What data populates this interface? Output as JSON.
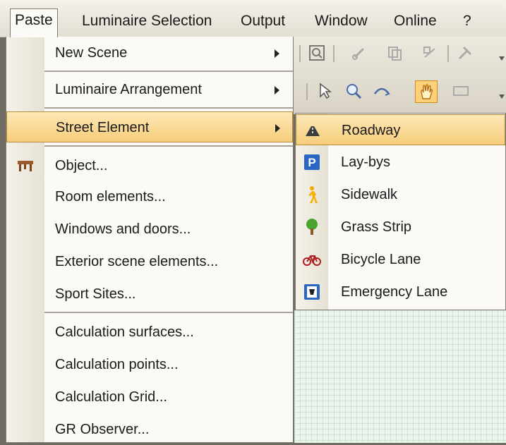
{
  "menubar": {
    "paste": "Paste",
    "luminaire_selection": "Luminaire Selection",
    "output": "Output",
    "window": "Window",
    "online": "Online",
    "help": "?"
  },
  "paste_menu": {
    "items": [
      {
        "label": "New Scene",
        "submenu": true
      },
      {
        "label": "Luminaire Arrangement",
        "submenu": true
      },
      {
        "label": "Street Element",
        "submenu": true,
        "highlighted": true
      },
      {
        "label": "Object...",
        "icon": "furniture-icon"
      },
      {
        "label": "Room elements..."
      },
      {
        "label": "Windows and doors..."
      },
      {
        "label": "Exterior scene elements..."
      },
      {
        "label": "Sport Sites..."
      },
      {
        "label": "Calculation surfaces..."
      },
      {
        "label": "Calculation points..."
      },
      {
        "label": "Calculation Grid..."
      },
      {
        "label": "GR Observer..."
      }
    ]
  },
  "street_element_submenu": {
    "items": [
      {
        "label": "Roadway",
        "icon": "roadway-icon",
        "highlighted": true
      },
      {
        "label": "Lay-bys",
        "icon": "parking-icon"
      },
      {
        "label": "Sidewalk",
        "icon": "pedestrian-icon"
      },
      {
        "label": "Grass Strip",
        "icon": "tree-icon"
      },
      {
        "label": "Bicycle Lane",
        "icon": "bicycle-icon"
      },
      {
        "label": "Emergency Lane",
        "icon": "emergency-phone-icon"
      }
    ]
  },
  "colors": {
    "highlight": "#f7cd7b",
    "highlight_border": "#b48a3c",
    "menu_bg": "#fbfaf6",
    "grid_bg": "#edf6ee"
  }
}
